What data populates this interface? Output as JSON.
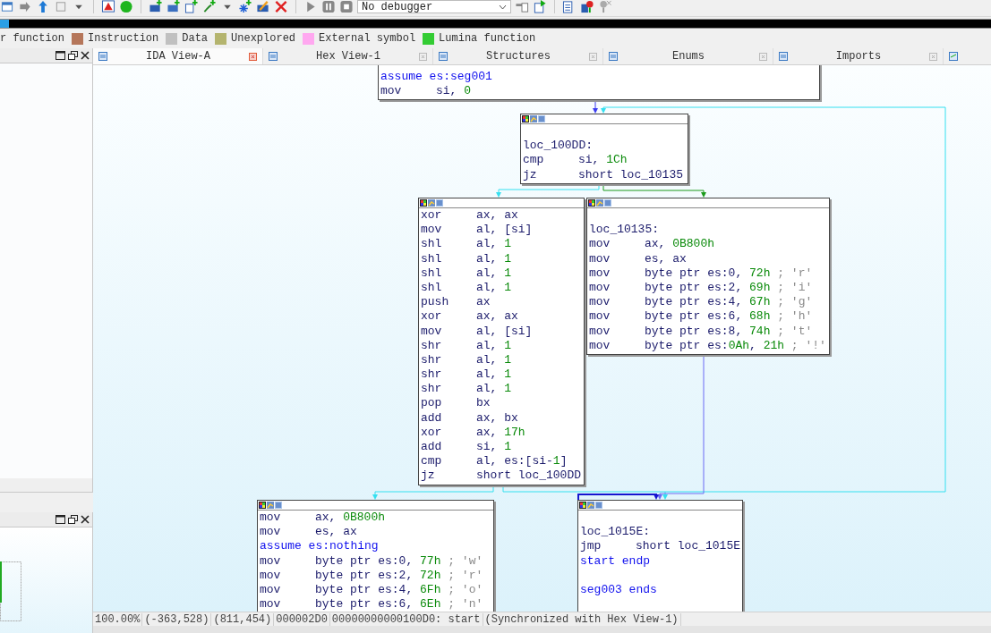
{
  "toolbar": {
    "debugger": {
      "value": "No debugger"
    }
  },
  "legend": [
    {
      "label": "r function"
    },
    {
      "label": "Instruction",
      "color": "#b5765a"
    },
    {
      "label": "Data",
      "color": "#c0c0c0"
    },
    {
      "label": "Unexplored",
      "color": "#b4b46e"
    },
    {
      "label": "External symbol",
      "color": "#ffa8f0"
    },
    {
      "label": "Lumina function",
      "color": "#33cc33"
    }
  ],
  "tabs": [
    {
      "label": "IDA View-A",
      "selected": true
    },
    {
      "label": "Hex View-1",
      "selected": false
    },
    {
      "label": "Structures",
      "selected": false
    },
    {
      "label": "Enums",
      "selected": false
    },
    {
      "label": "Imports",
      "selected": false
    }
  ],
  "graph": {
    "nodes": [
      {
        "header": false,
        "lines": [
          {
            "kind": "directive",
            "text": "assume es:seg001"
          },
          {
            "kind": "insn",
            "mnemonic": "mov",
            "operands": [
              {
                "text": "si, ",
                "kind": "plain"
              },
              {
                "text": "0",
                "kind": "number"
              }
            ]
          }
        ]
      },
      {
        "header": true,
        "lines": [
          {
            "kind": "blank"
          },
          {
            "kind": "label",
            "text": "loc_100DD:"
          },
          {
            "kind": "insn",
            "mnemonic": "cmp",
            "operands": [
              {
                "text": "si, ",
                "kind": "plain"
              },
              {
                "text": "1Ch",
                "kind": "number"
              }
            ]
          },
          {
            "kind": "insn",
            "mnemonic": "jz",
            "operands": [
              {
                "text": "short loc_10135",
                "kind": "plain"
              }
            ]
          }
        ]
      },
      {
        "header": true,
        "lines": [
          {
            "kind": "insn",
            "mnemonic": "xor",
            "operands": [
              {
                "text": "ax, ax",
                "kind": "plain"
              }
            ]
          },
          {
            "kind": "insn",
            "mnemonic": "mov",
            "operands": [
              {
                "text": "al, [si]",
                "kind": "plain"
              }
            ]
          },
          {
            "kind": "insn",
            "mnemonic": "shl",
            "operands": [
              {
                "text": "al, ",
                "kind": "plain"
              },
              {
                "text": "1",
                "kind": "number"
              }
            ]
          },
          {
            "kind": "insn",
            "mnemonic": "shl",
            "operands": [
              {
                "text": "al, ",
                "kind": "plain"
              },
              {
                "text": "1",
                "kind": "number"
              }
            ]
          },
          {
            "kind": "insn",
            "mnemonic": "shl",
            "operands": [
              {
                "text": "al, ",
                "kind": "plain"
              },
              {
                "text": "1",
                "kind": "number"
              }
            ]
          },
          {
            "kind": "insn",
            "mnemonic": "shl",
            "operands": [
              {
                "text": "al, ",
                "kind": "plain"
              },
              {
                "text": "1",
                "kind": "number"
              }
            ]
          },
          {
            "kind": "insn",
            "mnemonic": "push",
            "operands": [
              {
                "text": "ax",
                "kind": "plain"
              }
            ]
          },
          {
            "kind": "insn",
            "mnemonic": "xor",
            "operands": [
              {
                "text": "ax, ax",
                "kind": "plain"
              }
            ]
          },
          {
            "kind": "insn",
            "mnemonic": "mov",
            "operands": [
              {
                "text": "al, [si]",
                "kind": "plain"
              }
            ]
          },
          {
            "kind": "insn",
            "mnemonic": "shr",
            "operands": [
              {
                "text": "al, ",
                "kind": "plain"
              },
              {
                "text": "1",
                "kind": "number"
              }
            ]
          },
          {
            "kind": "insn",
            "mnemonic": "shr",
            "operands": [
              {
                "text": "al, ",
                "kind": "plain"
              },
              {
                "text": "1",
                "kind": "number"
              }
            ]
          },
          {
            "kind": "insn",
            "mnemonic": "shr",
            "operands": [
              {
                "text": "al, ",
                "kind": "plain"
              },
              {
                "text": "1",
                "kind": "number"
              }
            ]
          },
          {
            "kind": "insn",
            "mnemonic": "shr",
            "operands": [
              {
                "text": "al, ",
                "kind": "plain"
              },
              {
                "text": "1",
                "kind": "number"
              }
            ]
          },
          {
            "kind": "insn",
            "mnemonic": "pop",
            "operands": [
              {
                "text": "bx",
                "kind": "plain"
              }
            ]
          },
          {
            "kind": "insn",
            "mnemonic": "add",
            "operands": [
              {
                "text": "ax, bx",
                "kind": "plain"
              }
            ]
          },
          {
            "kind": "insn",
            "mnemonic": "xor",
            "operands": [
              {
                "text": "ax, ",
                "kind": "plain"
              },
              {
                "text": "17h",
                "kind": "number"
              }
            ]
          },
          {
            "kind": "insn",
            "mnemonic": "add",
            "operands": [
              {
                "text": "si, ",
                "kind": "plain"
              },
              {
                "text": "1",
                "kind": "number"
              }
            ]
          },
          {
            "kind": "insn",
            "mnemonic": "cmp",
            "operands": [
              {
                "text": "al, es:[si-",
                "kind": "plain"
              },
              {
                "text": "1",
                "kind": "number"
              },
              {
                "text": "]",
                "kind": "plain"
              }
            ]
          },
          {
            "kind": "insn",
            "mnemonic": "jz",
            "operands": [
              {
                "text": "short loc_100DD",
                "kind": "plain"
              }
            ]
          }
        ]
      },
      {
        "header": true,
        "lines": [
          {
            "kind": "blank"
          },
          {
            "kind": "label",
            "text": "loc_10135:"
          },
          {
            "kind": "insn",
            "mnemonic": "mov",
            "operands": [
              {
                "text": "ax, ",
                "kind": "plain"
              },
              {
                "text": "0B800h",
                "kind": "number"
              }
            ]
          },
          {
            "kind": "insn",
            "mnemonic": "mov",
            "operands": [
              {
                "text": "es, ax",
                "kind": "plain"
              }
            ]
          },
          {
            "kind": "insn",
            "mnemonic": "mov",
            "operands": [
              {
                "text": "byte ptr es:0, ",
                "kind": "plain"
              },
              {
                "text": "72h",
                "kind": "number"
              }
            ],
            "comment": "; 'r'"
          },
          {
            "kind": "insn",
            "mnemonic": "mov",
            "operands": [
              {
                "text": "byte ptr es:2, ",
                "kind": "plain"
              },
              {
                "text": "69h",
                "kind": "number"
              }
            ],
            "comment": "; 'i'"
          },
          {
            "kind": "insn",
            "mnemonic": "mov",
            "operands": [
              {
                "text": "byte ptr es:4, ",
                "kind": "plain"
              },
              {
                "text": "67h",
                "kind": "number"
              }
            ],
            "comment": "; 'g'"
          },
          {
            "kind": "insn",
            "mnemonic": "mov",
            "operands": [
              {
                "text": "byte ptr es:6, ",
                "kind": "plain"
              },
              {
                "text": "68h",
                "kind": "number"
              }
            ],
            "comment": "; 'h'"
          },
          {
            "kind": "insn",
            "mnemonic": "mov",
            "operands": [
              {
                "text": "byte ptr es:8, ",
                "kind": "plain"
              },
              {
                "text": "74h",
                "kind": "number"
              }
            ],
            "comment": "; 't'"
          },
          {
            "kind": "insn",
            "mnemonic": "mov",
            "operands": [
              {
                "text": "byte ptr es:",
                "kind": "plain"
              },
              {
                "text": "0Ah",
                "kind": "number"
              },
              {
                "text": ", ",
                "kind": "plain"
              },
              {
                "text": "21h",
                "kind": "number"
              }
            ],
            "comment": "; '!'"
          }
        ]
      },
      {
        "header": true,
        "lines": [
          {
            "kind": "insn",
            "mnemonic": "mov",
            "operands": [
              {
                "text": "ax, ",
                "kind": "plain"
              },
              {
                "text": "0B800h",
                "kind": "number"
              }
            ]
          },
          {
            "kind": "insn",
            "mnemonic": "mov",
            "operands": [
              {
                "text": "es, ax",
                "kind": "plain"
              }
            ]
          },
          {
            "kind": "directive",
            "text": "assume es:nothing"
          },
          {
            "kind": "insn",
            "mnemonic": "mov",
            "operands": [
              {
                "text": "byte ptr es:0, ",
                "kind": "plain"
              },
              {
                "text": "77h",
                "kind": "number"
              }
            ],
            "comment": "; 'w'"
          },
          {
            "kind": "insn",
            "mnemonic": "mov",
            "operands": [
              {
                "text": "byte ptr es:2, ",
                "kind": "plain"
              },
              {
                "text": "72h",
                "kind": "number"
              }
            ],
            "comment": "; 'r'"
          },
          {
            "kind": "insn",
            "mnemonic": "mov",
            "operands": [
              {
                "text": "byte ptr es:4, ",
                "kind": "plain"
              },
              {
                "text": "6Fh",
                "kind": "number"
              }
            ],
            "comment": "; 'o'"
          },
          {
            "kind": "insn",
            "mnemonic": "mov",
            "operands": [
              {
                "text": "byte ptr es:6, ",
                "kind": "plain"
              },
              {
                "text": "6Eh",
                "kind": "number"
              }
            ],
            "comment": "; 'n'"
          }
        ]
      },
      {
        "header": true,
        "lines": [
          {
            "kind": "blank"
          },
          {
            "kind": "label",
            "text": "loc_1015E:"
          },
          {
            "kind": "insn",
            "mnemonic": "jmp",
            "operands": [
              {
                "text": "short loc_1015E",
                "kind": "plain"
              }
            ]
          },
          {
            "kind": "directive",
            "text": "start endp"
          },
          {
            "kind": "blank"
          },
          {
            "kind": "directive",
            "text": "seg003 ends"
          }
        ]
      }
    ]
  },
  "status_bar": [
    "100.00%",
    "(-363,528)",
    "(811,454)",
    "000002D0",
    "00000000000100D0: start",
    "(Synchronized with Hex View-1)"
  ]
}
